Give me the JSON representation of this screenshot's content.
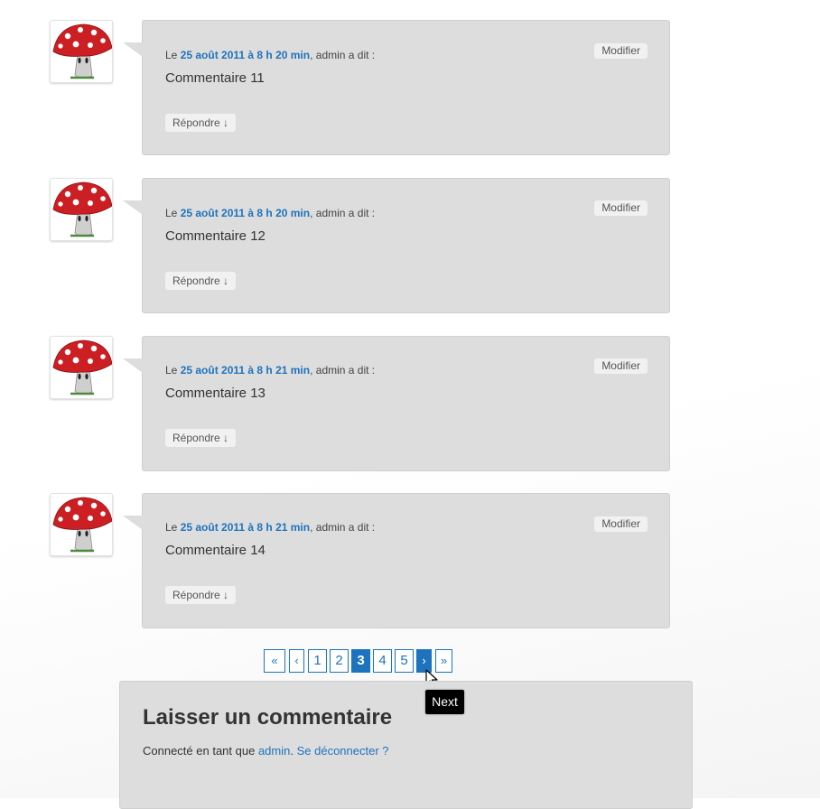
{
  "comments": [
    {
      "meta_prefix": "Le ",
      "date": "25 août 2011 à 8 h 20 min",
      "meta_suffix": ", admin a dit :",
      "text": "Commentaire 11",
      "edit_label": "Modifier",
      "reply_label": "Répondre ↓"
    },
    {
      "meta_prefix": "Le ",
      "date": "25 août 2011 à 8 h 20 min",
      "meta_suffix": ", admin a dit :",
      "text": "Commentaire 12",
      "edit_label": "Modifier",
      "reply_label": "Répondre ↓"
    },
    {
      "meta_prefix": "Le ",
      "date": "25 août 2011 à 8 h 21 min",
      "meta_suffix": ", admin a dit :",
      "text": "Commentaire 13",
      "edit_label": "Modifier",
      "reply_label": "Répondre ↓"
    },
    {
      "meta_prefix": "Le ",
      "date": "25 août 2011 à 8 h 21 min",
      "meta_suffix": ", admin a dit :",
      "text": "Commentaire 14",
      "edit_label": "Modifier",
      "reply_label": "Répondre ↓"
    }
  ],
  "avatar_icon": "mushroom-avatar-icon",
  "pagination": {
    "first": "«",
    "prev": "‹",
    "pages": [
      "1",
      "2",
      "3",
      "4",
      "5"
    ],
    "current": "3",
    "next": "›",
    "last": "»",
    "hovered": "next"
  },
  "tooltip": "Next",
  "respond": {
    "title": "Laisser un commentaire",
    "logged_prefix": "Connecté en tant que ",
    "user": "admin",
    "separator": ". ",
    "logout": "Se déconnecter ?"
  },
  "colors": {
    "link": "#1e73be",
    "bubble_bg": "#dddddd",
    "button_bg": "#f1f1f1",
    "page_current_bg": "#1e73be"
  }
}
